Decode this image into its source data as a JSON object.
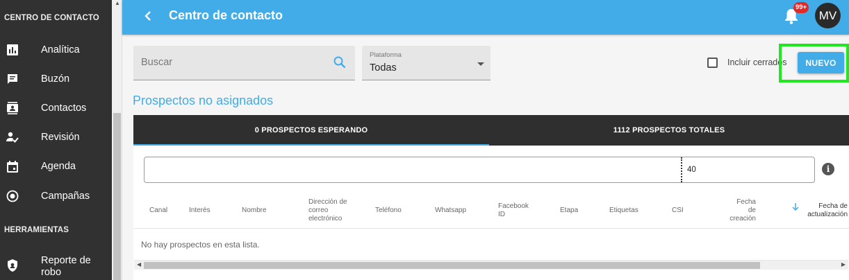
{
  "sidebar": {
    "section1": "CENTRO DE CONTACTO",
    "items": [
      {
        "label": "Analítica",
        "icon": "bar-chart-icon"
      },
      {
        "label": "Buzón",
        "icon": "inbox-icon"
      },
      {
        "label": "Contactos",
        "icon": "contacts-icon"
      },
      {
        "label": "Revisión",
        "icon": "person-check-icon"
      },
      {
        "label": "Agenda",
        "icon": "calendar-icon"
      },
      {
        "label": "Campañas",
        "icon": "radio-target-icon"
      }
    ],
    "section2": "HERRAMIENTAS",
    "tools": [
      {
        "label": "Reporte de robo",
        "icon": "shield-icon"
      }
    ]
  },
  "header": {
    "title": "Centro de contacto",
    "notifications_badge": "99+",
    "avatar_initials": "MV"
  },
  "toolbar": {
    "search_placeholder": "Buscar",
    "platform_label": "Plataforma",
    "platform_value": "Todas",
    "include_closed_label": "Incluir cerrados",
    "new_button_label": "NUEVO"
  },
  "page": {
    "heading": "Prospectos no asignados"
  },
  "tabs": [
    {
      "label": "0 PROSPECTOS ESPERANDO",
      "active": true
    },
    {
      "label": "1112 PROSPECTOS TOTALES",
      "active": false
    }
  ],
  "filter": {
    "value": "40"
  },
  "table": {
    "columns": [
      "Canal",
      "Interés",
      "Nombre",
      "Dirección de correo electrónico",
      "Teléfono",
      "Whatsapp",
      "Facebook ID",
      "Etapa",
      "Etiquetas",
      "CSI",
      "Fecha de creación",
      "Fecha de actualización"
    ],
    "empty_message": "No hay prospectos en esta lista."
  },
  "colors": {
    "accent": "#42ace8",
    "sidebar": "#313131",
    "highlight": "#1ee81e",
    "badge": "#e32828"
  }
}
